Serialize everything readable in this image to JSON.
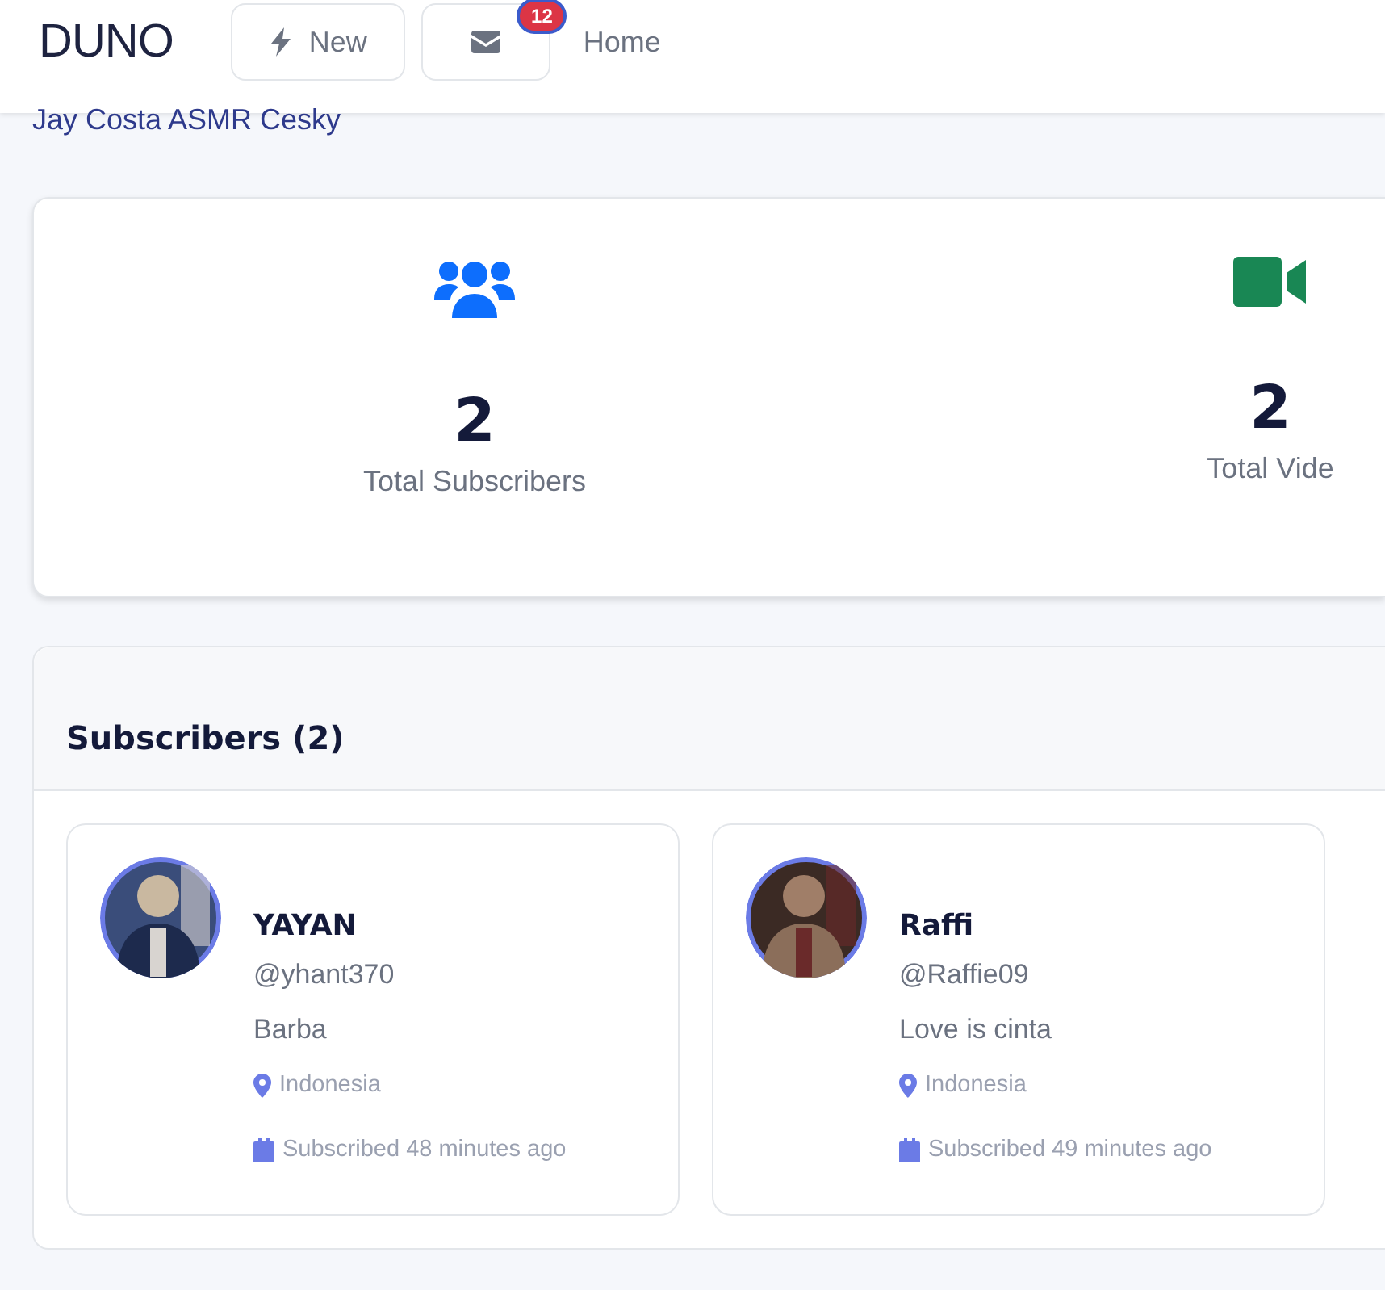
{
  "header": {
    "logo": "DUNO",
    "new_button": "New",
    "messages_badge": "12",
    "nav_link": "Home"
  },
  "breadcrumb": "Jay Costa ASMR Cesky",
  "stats": [
    {
      "kind": "subscribers",
      "value": "2",
      "label": "Total Subscribers"
    },
    {
      "kind": "videos",
      "value": "2",
      "label": "Total Vide"
    }
  ],
  "subscribers_panel": {
    "title": "Subscribers (2)",
    "subscribers": [
      {
        "name": "YAYAN",
        "handle": "@yhant370",
        "bio": "Barba",
        "location": "Indonesia",
        "subscribed": "Subscribed 48 minutes ago"
      },
      {
        "name": "Raffi",
        "handle": "@Raffie09",
        "bio": "Love is cinta",
        "location": "Indonesia",
        "subscribed": "Subscribed 49 minutes ago"
      }
    ]
  }
}
